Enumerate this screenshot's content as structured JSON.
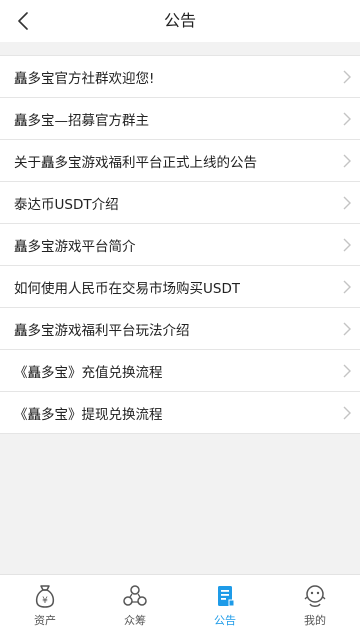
{
  "header": {
    "title": "公告"
  },
  "announcements": [
    {
      "label": "矗多宝官方社群欢迎您!"
    },
    {
      "label": "矗多宝—招募官方群主"
    },
    {
      "label": "关于矗多宝游戏福利平台正式上线的公告"
    },
    {
      "label": "泰达币USDT介绍"
    },
    {
      "label": "矗多宝游戏平台简介"
    },
    {
      "label": "如何使用人民币在交易市场购买USDT"
    },
    {
      "label": "矗多宝游戏福利平台玩法介绍"
    },
    {
      "label": "《矗多宝》充值兑换流程"
    },
    {
      "label": "《矗多宝》提现兑换流程"
    }
  ],
  "tabbar": {
    "tabs": [
      {
        "label": "资产",
        "icon": "money-bag-icon"
      },
      {
        "label": "众筹",
        "icon": "crowdfund-icon"
      },
      {
        "label": "公告",
        "icon": "document-icon",
        "active": true
      },
      {
        "label": "我的",
        "icon": "profile-icon"
      }
    ],
    "active_color": "#1e9be8",
    "inactive_color": "#555555"
  }
}
